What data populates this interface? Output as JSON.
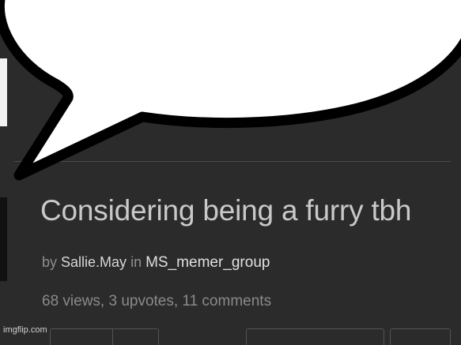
{
  "post": {
    "title": "Considering being a furry tbh",
    "by_word": "by",
    "author": "Sallie.May",
    "in_word": "in",
    "group": "MS_memer_group",
    "stats": "68 views, 3 upvotes, 11 comments"
  },
  "watermark": "imgflip.com",
  "bubble": {
    "text": ""
  },
  "colors": {
    "background": "#2b2b2b",
    "title": "#c9c9c9",
    "muted": "#8e8e8e",
    "bubble_fill": "#ffffff",
    "bubble_outline": "#000000"
  }
}
